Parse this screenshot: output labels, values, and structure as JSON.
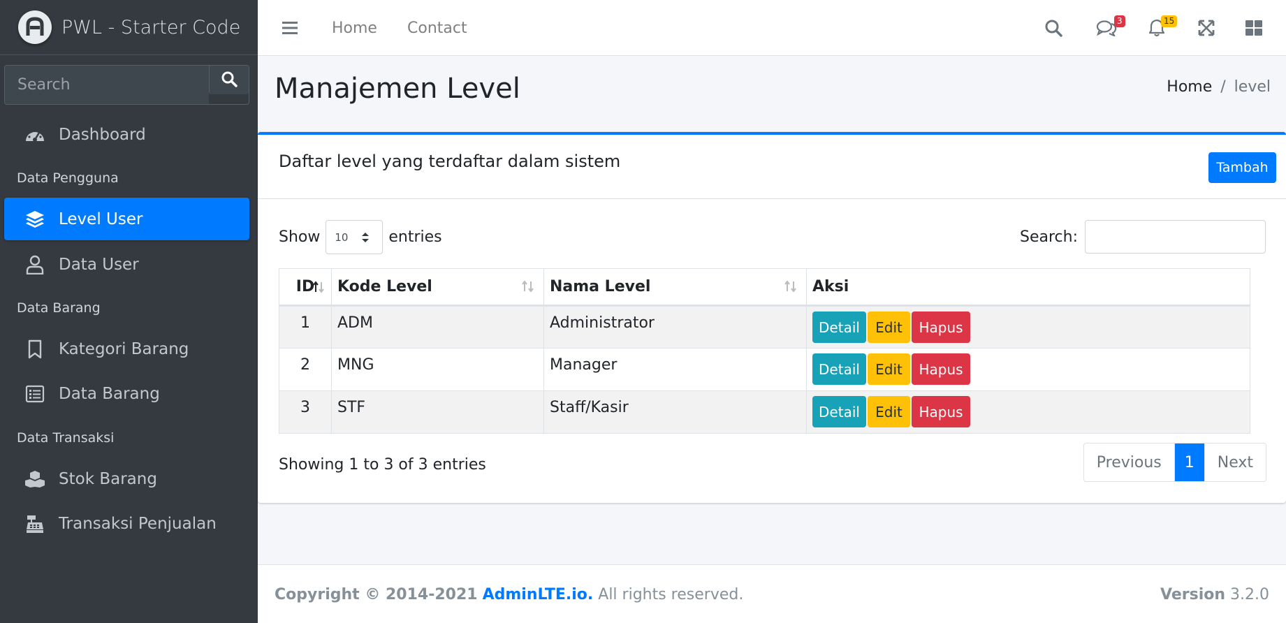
{
  "brand": {
    "name": "PWL - Starter Code"
  },
  "sidebar": {
    "search_placeholder": "Search",
    "dashboard": "Dashboard",
    "header_pengguna": "Data Pengguna",
    "level_user": "Level User",
    "data_user": "Data User",
    "header_barang": "Data Barang",
    "kategori_barang": "Kategori Barang",
    "data_barang": "Data Barang",
    "header_transaksi": "Data Transaksi",
    "stok_barang": "Stok Barang",
    "transaksi_penjualan": "Transaksi Penjualan"
  },
  "topnav": {
    "home": "Home",
    "contact": "Contact",
    "messages_count": "3",
    "notifications_count": "15"
  },
  "page": {
    "title": "Manajemen Level",
    "breadcrumb_home": "Home",
    "breadcrumb_sep": "/",
    "breadcrumb_current": "level"
  },
  "card": {
    "title": "Daftar level yang terdaftar dalam sistem",
    "add_button": "Tambah"
  },
  "datatable": {
    "show_label": "Show",
    "entries_label": "entries",
    "page_length": "10",
    "search_label": "Search:",
    "columns": [
      "ID",
      "Kode Level",
      "Nama Level",
      "Aksi"
    ],
    "rows": [
      {
        "id": "1",
        "kode": "ADM",
        "nama": "Administrator"
      },
      {
        "id": "2",
        "kode": "MNG",
        "nama": "Manager"
      },
      {
        "id": "3",
        "kode": "STF",
        "nama": "Staff/Kasir"
      }
    ],
    "action_detail": "Detail",
    "action_edit": "Edit",
    "action_hapus": "Hapus",
    "info": "Showing 1 to 3 of 3 entries",
    "prev": "Previous",
    "page": "1",
    "next": "Next"
  },
  "footer": {
    "copyright": "Copyright © 2014-2021",
    "link": "AdminLTE.io.",
    "rights": "All rights reserved.",
    "version_label": "Version",
    "version": "3.2.0"
  },
  "colors": {
    "primary": "#007bff",
    "sidebar": "#343a40",
    "info": "#17a2b8",
    "warning": "#ffc107",
    "danger": "#dc3545"
  }
}
